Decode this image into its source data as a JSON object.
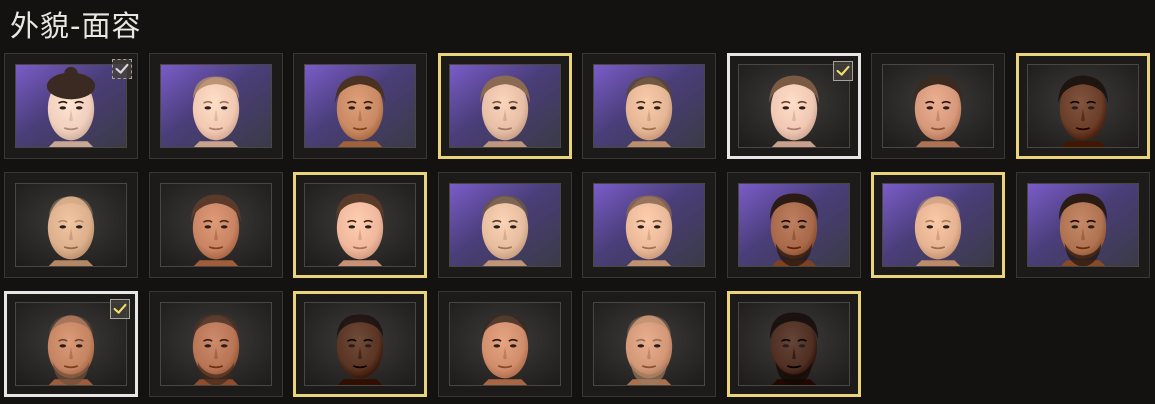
{
  "header": {
    "title": "外貌-面容"
  },
  "colors": {
    "selected_gold": "#e9d47a",
    "current_white": "#e6e6e6",
    "check_yellow": "#f0de6a",
    "check_gray": "#d8d8d8"
  },
  "faces": [
    {
      "bg": "purple",
      "skin": "#f0cfbd",
      "hair": "#3b2a22",
      "hair_style": "bun",
      "beard": false,
      "frame": "none",
      "check": "gray"
    },
    {
      "bg": "purple",
      "skin": "#f2c9b2",
      "hair": "#b08a6a",
      "hair_style": "buzz",
      "beard": false,
      "frame": "none",
      "check": "none"
    },
    {
      "bg": "purple",
      "skin": "#c98a63",
      "hair": "#4a3222",
      "hair_style": "tied",
      "beard": false,
      "frame": "none",
      "check": "none"
    },
    {
      "bg": "purple",
      "skin": "#e7bfa6",
      "hair": "#8a6a52",
      "hair_style": "tied",
      "beard": false,
      "frame": "gold",
      "check": "none"
    },
    {
      "bg": "purple",
      "skin": "#e4b695",
      "hair": "#5a4532",
      "hair_style": "buzz",
      "beard": false,
      "frame": "none",
      "check": "none"
    },
    {
      "bg": "dark",
      "skin": "#f0c8b3",
      "hair": "#7a5a42",
      "hair_style": "tied",
      "beard": false,
      "frame": "white",
      "check": "yellow"
    },
    {
      "bg": "dark",
      "skin": "#d7997b",
      "hair": "#3a2a20",
      "hair_style": "tied",
      "beard": false,
      "frame": "none",
      "check": "none"
    },
    {
      "bg": "dark",
      "skin": "#6b3e2a",
      "hair": "#1e1410",
      "hair_style": "tied",
      "beard": false,
      "frame": "gold",
      "check": "none"
    },
    {
      "bg": "dark",
      "skin": "#ddb08d",
      "hair": "#c8a07c",
      "hair_style": "bald",
      "beard": false,
      "frame": "none",
      "check": "none"
    },
    {
      "bg": "dark",
      "skin": "#c98563",
      "hair": "#5a3a2a",
      "hair_style": "tied",
      "beard": false,
      "frame": "none",
      "check": "none"
    },
    {
      "bg": "dark",
      "skin": "#f0b89c",
      "hair": "#5a3a28",
      "hair_style": "short",
      "beard": false,
      "frame": "gold",
      "check": "none"
    },
    {
      "bg": "purple",
      "skin": "#e6bd9f",
      "hair": "#6a5545",
      "hair_style": "buzz",
      "beard": false,
      "frame": "none",
      "check": "none"
    },
    {
      "bg": "purple",
      "skin": "#e9b999",
      "hair": "#8a6650",
      "hair_style": "buzz",
      "beard": false,
      "frame": "none",
      "check": "none"
    },
    {
      "bg": "purple",
      "skin": "#a8694a",
      "hair": "#2a1c14",
      "hair_style": "short",
      "beard": true,
      "frame": "none",
      "check": "none"
    },
    {
      "bg": "purple",
      "skin": "#e6b392",
      "hair": "#b89070",
      "hair_style": "bald",
      "beard": false,
      "frame": "gold",
      "check": "none"
    },
    {
      "bg": "purple",
      "skin": "#b07352",
      "hair": "#2a1c14",
      "hair_style": "short",
      "beard": true,
      "frame": "none",
      "check": "none"
    },
    {
      "bg": "dark",
      "skin": "#c58462",
      "hair": "#7a5a46",
      "hair_style": "bald",
      "beard": true,
      "frame": "white",
      "check": "yellow"
    },
    {
      "bg": "dark",
      "skin": "#b87556",
      "hair": "#4a3226",
      "hair_style": "buzz",
      "beard": true,
      "frame": "none",
      "check": "none"
    },
    {
      "bg": "dark",
      "skin": "#5a3524",
      "hair": "#1a1210",
      "hair_style": "buzz",
      "beard": false,
      "frame": "gold",
      "check": "none"
    },
    {
      "bg": "dark",
      "skin": "#d18e6c",
      "hair": "#3a2a22",
      "hair_style": "buzz",
      "beard": false,
      "frame": "none",
      "check": "none"
    },
    {
      "bg": "dark",
      "skin": "#d29878",
      "hair": "#a88468",
      "hair_style": "bald",
      "beard": true,
      "frame": "none",
      "check": "none"
    },
    {
      "bg": "dark",
      "skin": "#4e2f22",
      "hair": "#1a120e",
      "hair_style": "short",
      "beard": true,
      "frame": "gold",
      "check": "none"
    }
  ]
}
